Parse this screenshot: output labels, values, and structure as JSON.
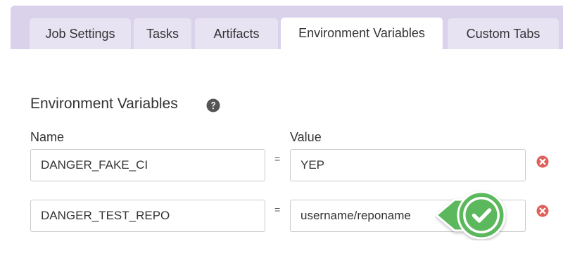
{
  "tabs": [
    {
      "label": "Job Settings",
      "active": false
    },
    {
      "label": "Tasks",
      "active": false
    },
    {
      "label": "Artifacts",
      "active": false
    },
    {
      "label": "Environment Variables",
      "active": true
    },
    {
      "label": "Custom Tabs",
      "active": false
    }
  ],
  "section": {
    "title": "Environment Variables",
    "help_icon": "question-circle-icon"
  },
  "columns": {
    "name_label": "Name",
    "value_label": "Value"
  },
  "variables": [
    {
      "name": "DANGER_FAKE_CI",
      "separator": "=",
      "value": "YEP"
    },
    {
      "name": "DANGER_TEST_REPO",
      "separator": "=",
      "value": "username/reponame"
    }
  ],
  "icons": {
    "remove": "remove-circle-icon",
    "success": "checkmark-badge-icon"
  },
  "colors": {
    "tabbar_bg": "#d9d2ea",
    "tab_bg": "#e8e3f3",
    "remove_red": "#e0605a",
    "success_green": "#5cb85c"
  }
}
